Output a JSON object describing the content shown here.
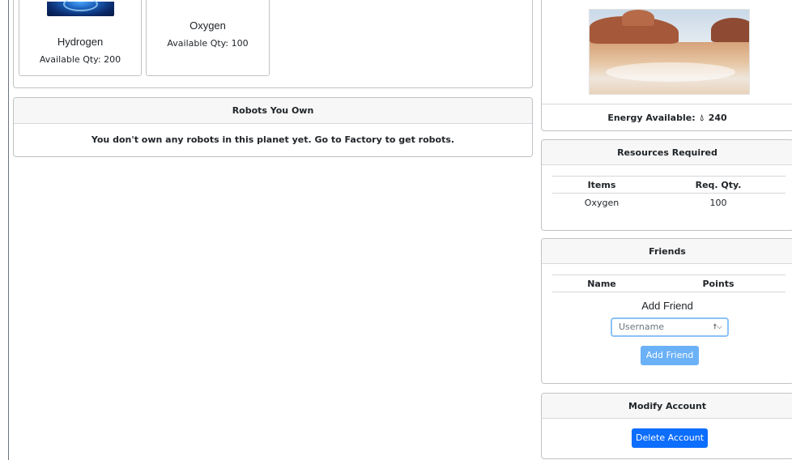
{
  "resources": [
    {
      "name": "Hydrogen",
      "qty": "Available Qty: 200"
    },
    {
      "name": "Oxygen",
      "qty": "Available Qty: 100"
    }
  ],
  "robots": {
    "title": "Robots You Own",
    "message": "You don't own any robots in this planet yet. Go to Factory to get robots."
  },
  "planet": {
    "energy_label": "Energy Available:",
    "energy_value": "240",
    "energy_icon": "droplet-icon"
  },
  "resources_required": {
    "title": "Resources Required",
    "headers": [
      "Items",
      "Req. Qty."
    ],
    "rows": [
      [
        "Oxygen",
        "100"
      ]
    ]
  },
  "friends": {
    "title": "Friends",
    "headers": [
      "Name",
      "Points"
    ],
    "add_title": "Add Friend",
    "username_placeholder": "Username",
    "add_button": "Add Friend"
  },
  "modify_account": {
    "title": "Modify Account",
    "delete_button": "Delete Account"
  },
  "colors": {
    "primary": "#0d6efd",
    "primary_disabled": "#6bb1f7",
    "border": "#bfc3c7",
    "header_bg": "#f7f7f7"
  }
}
